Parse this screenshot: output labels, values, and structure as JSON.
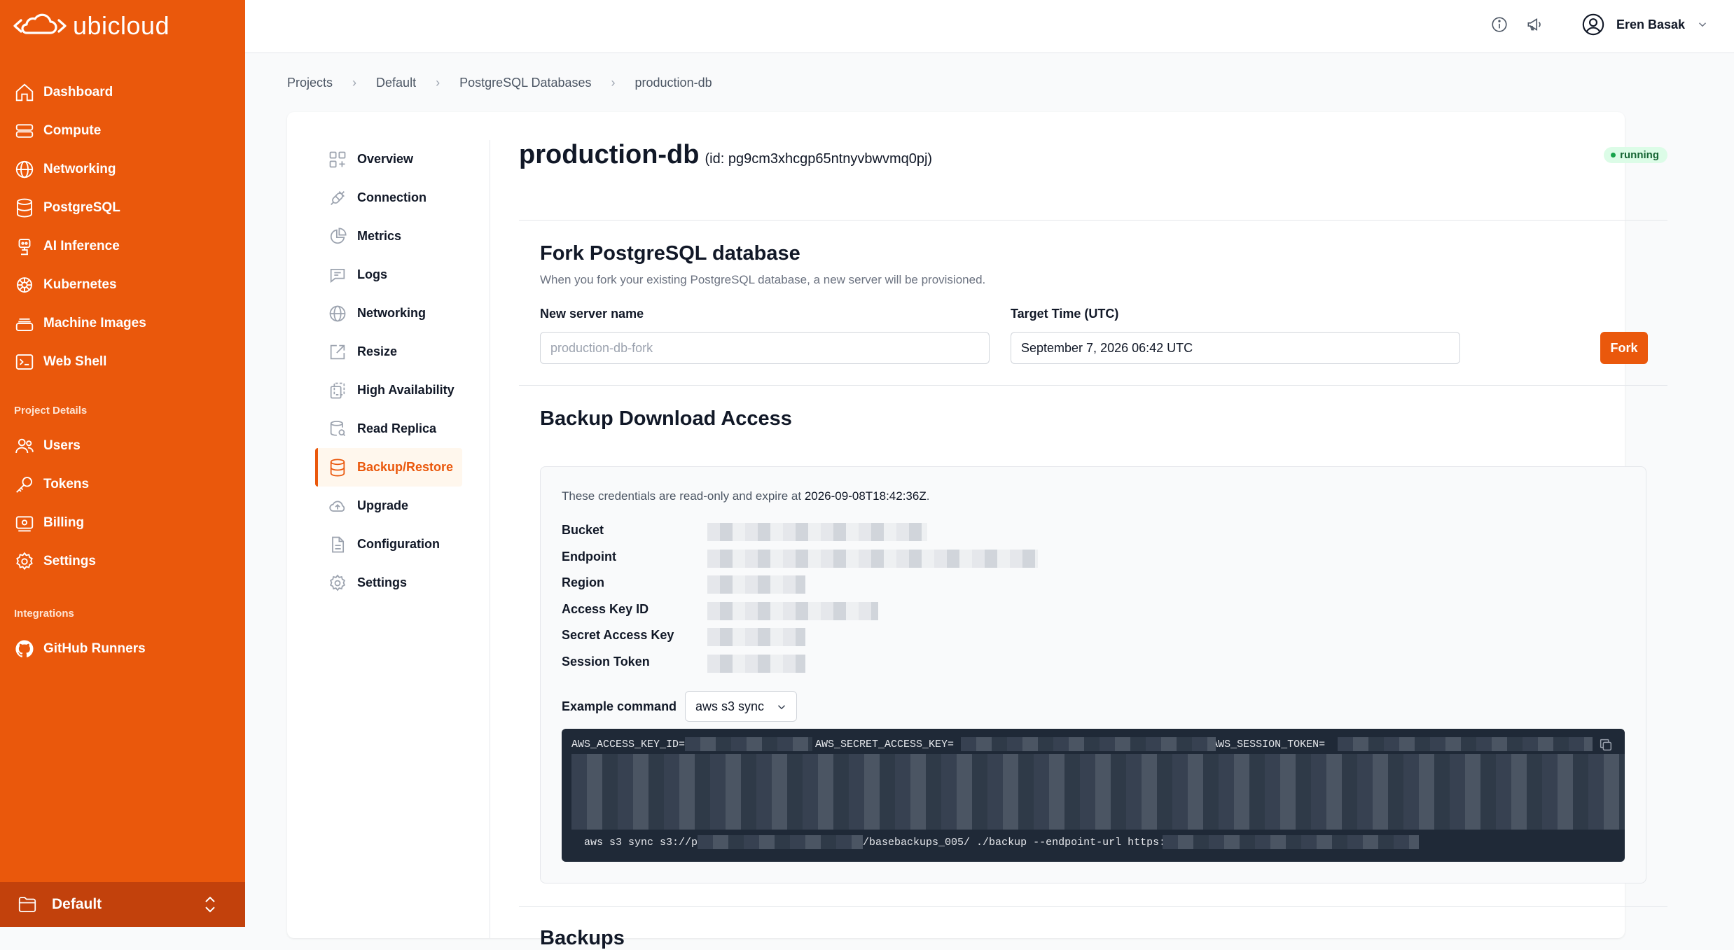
{
  "brand": {
    "name": "ubicloud",
    "accent": "#ea580c"
  },
  "sidebar": {
    "items": [
      {
        "label": "Dashboard",
        "icon": "home-icon"
      },
      {
        "label": "Compute",
        "icon": "server-icon"
      },
      {
        "label": "Networking",
        "icon": "globe-icon"
      },
      {
        "label": "PostgreSQL",
        "icon": "database-icon"
      },
      {
        "label": "AI Inference",
        "icon": "robot-icon"
      },
      {
        "label": "Kubernetes",
        "icon": "helm-icon"
      },
      {
        "label": "Machine Images",
        "icon": "image-stack-icon"
      },
      {
        "label": "Web Shell",
        "icon": "terminal-icon"
      }
    ],
    "project_section": "Project Details",
    "project_items": [
      {
        "label": "Users",
        "icon": "users-icon"
      },
      {
        "label": "Tokens",
        "icon": "key-icon"
      },
      {
        "label": "Billing",
        "icon": "billing-icon"
      },
      {
        "label": "Settings",
        "icon": "gear-icon"
      }
    ],
    "integrations_section": "Integrations",
    "integration_items": [
      {
        "label": "GitHub Runners",
        "icon": "github-icon"
      }
    ],
    "project_switcher": "Default"
  },
  "topbar": {
    "user_name": "Eren Basak"
  },
  "breadcrumb": [
    "Projects",
    "Default",
    "PostgreSQL Databases",
    "production-db"
  ],
  "db": {
    "name": "production-db",
    "id_text": "(id: pg9cm3xhcgp65ntnyvbwvmq0pj)",
    "status": "running"
  },
  "subnav": [
    {
      "label": "Overview",
      "icon": "overview-icon"
    },
    {
      "label": "Connection",
      "icon": "plug-icon"
    },
    {
      "label": "Metrics",
      "icon": "pie-chart-icon"
    },
    {
      "label": "Logs",
      "icon": "chat-icon"
    },
    {
      "label": "Networking",
      "icon": "globe-icon"
    },
    {
      "label": "Resize",
      "icon": "resize-icon"
    },
    {
      "label": "High Availability",
      "icon": "copy-stack-icon"
    },
    {
      "label": "Read Replica",
      "icon": "database-search-icon"
    },
    {
      "label": "Backup/Restore",
      "icon": "database-icon",
      "active": true
    },
    {
      "label": "Upgrade",
      "icon": "cloud-upload-icon"
    },
    {
      "label": "Configuration",
      "icon": "document-icon"
    },
    {
      "label": "Settings",
      "icon": "gear-icon"
    }
  ],
  "fork": {
    "title": "Fork PostgreSQL database",
    "description": "When you fork your existing PostgreSQL database, a new server will be provisioned.",
    "server_name_label": "New server name",
    "server_name_placeholder": "production-db-fork",
    "target_time_label": "Target Time (UTC)",
    "target_time_value": "September 7, 2026 06:42 UTC",
    "button": "Fork"
  },
  "backup_access": {
    "title": "Backup Download Access",
    "expire_prefix": "These credentials are read-only and expire at ",
    "expire_time": "2026-09-08T18:42:36Z",
    "expire_suffix": ".",
    "labels": [
      "Bucket",
      "Endpoint",
      "Region",
      "Access Key ID",
      "Secret Access Key",
      "Session Token"
    ],
    "example_label": "Example command",
    "example_selected": "aws s3 sync",
    "code_key_id": "AWS_ACCESS_KEY_ID=",
    "code_secret": "AWS_SECRET_ACCESS_KEY=",
    "code_token": "AWS_SESSION_TOKEN=",
    "code_cmd_a": "aws s3 sync s3://p",
    "code_cmd_b": "/basebackups_005/ ./backup --endpoint-url https://"
  },
  "backups": {
    "title": "Backups"
  }
}
